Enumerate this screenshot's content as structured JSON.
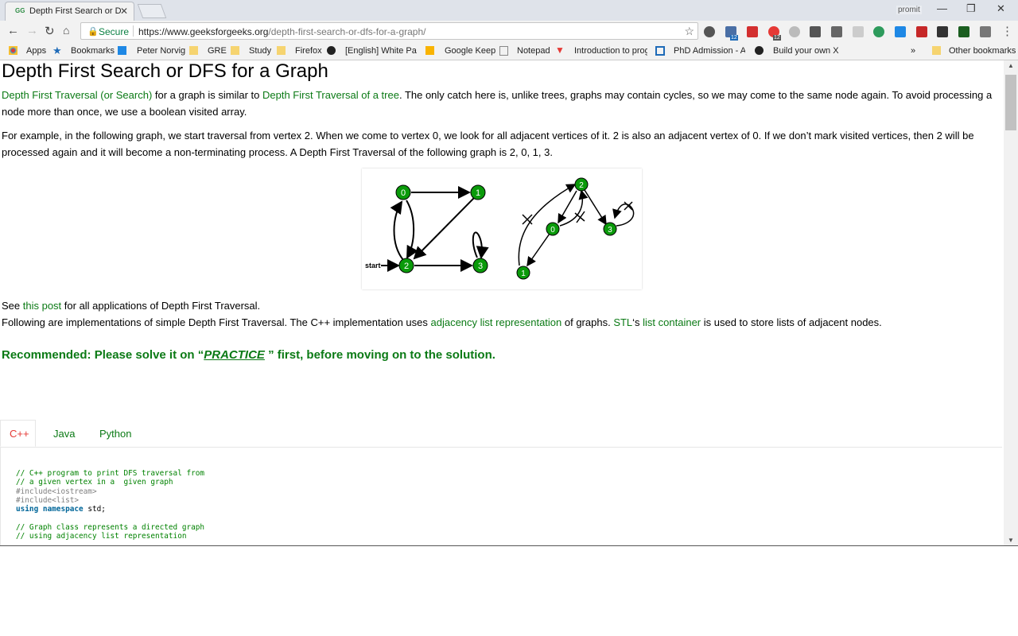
{
  "browser": {
    "tab_title": "Depth First Search or DFS for a Graph",
    "tab_favicon": "GG",
    "tab_close": "✕",
    "profile_name": "promit",
    "url_secure_label": "Secure",
    "url_host": "https://www.geeksforgeeks.org",
    "url_path": "/depth-first-search-or-dfs-for-a-graph/",
    "window_controls": [
      "minimize-icon",
      "restore-icon",
      "close-icon"
    ],
    "nav_icons": [
      "back-arrow-icon",
      "forward-arrow-icon",
      "reload-icon",
      "home-icon"
    ],
    "extension_badges": [
      "12",
      "12"
    ]
  },
  "bookmarks": {
    "items": [
      {
        "label": "Apps",
        "icon": "apps-icon"
      },
      {
        "label": "Bookmarks",
        "icon": "star-icon"
      },
      {
        "label": "Peter Norvig",
        "icon": "page-icon"
      },
      {
        "label": "GRE",
        "icon": "folder-icon"
      },
      {
        "label": "Study",
        "icon": "folder-icon"
      },
      {
        "label": "Firefox",
        "icon": "folder-icon"
      },
      {
        "label": "[English] White Pape",
        "icon": "github-icon"
      },
      {
        "label": "Google Keep",
        "icon": "keep-icon"
      },
      {
        "label": "Notepad",
        "icon": "page-icon"
      },
      {
        "label": "Introduction to prog",
        "icon": "video-icon"
      },
      {
        "label": "PhD Admission - Aft",
        "icon": "page-icon"
      },
      {
        "label": "Build your own X",
        "icon": "github-icon"
      }
    ],
    "overflow": "»",
    "other": "Other bookmarks"
  },
  "article": {
    "title": "Depth First Search or DFS for a Graph",
    "p1_link1": "Depth First Traversal (or Search)",
    "p1_text1": " for a graph is similar to ",
    "p1_link2": "Depth First Traversal of a tree",
    "p1_text2": ". The only catch here is, unlike trees, graphs may contain cycles, so we may come to the same node again. To avoid processing a node more than once, we use a boolean visited array.",
    "p2": "For example, in the following graph, we start traversal from vertex 2. When we come to vertex 0, we look for all adjacent vertices of it. 2 is also an adjacent vertex of 0. If we don’t mark visited vertices, then 2 will be processed again and it will become a non-terminating process. A Depth First Traversal of the following graph is 2, 0, 1, 3.",
    "figure": {
      "left_graph_nodes": [
        "0",
        "1",
        "2",
        "3"
      ],
      "start_label": "start",
      "right_graph_nodes": [
        "2",
        "0",
        "3",
        "1"
      ]
    },
    "p3_text1": "See ",
    "p3_link": "this post",
    "p3_text2": " for all applications of Depth First Traversal.",
    "p4_text1": "Following are implementations of simple Depth First Traversal. The C++ implementation uses ",
    "p4_link1": "adjacency list representation",
    "p4_text2": " of graphs. ",
    "p4_link2": "STL",
    "p4_text3": "‘s ",
    "p4_link3": "list container",
    "p4_text4": " is used to store lists of adjacent nodes.",
    "reco_text1": "Recommended: Please solve it on “",
    "reco_link": "PRACTICE",
    "reco_text2": " ” first, before moving on to the solution.",
    "code_tabs": [
      "C++",
      "Java",
      "Python"
    ],
    "code_lines": [
      "// C++ program to print DFS traversal from",
      "// a given vertex in a  given graph",
      "#include<iostream>",
      "#include<list>",
      "using namespace std;",
      "",
      "// Graph class represents a directed graph",
      "// using adjacency list representation"
    ]
  }
}
